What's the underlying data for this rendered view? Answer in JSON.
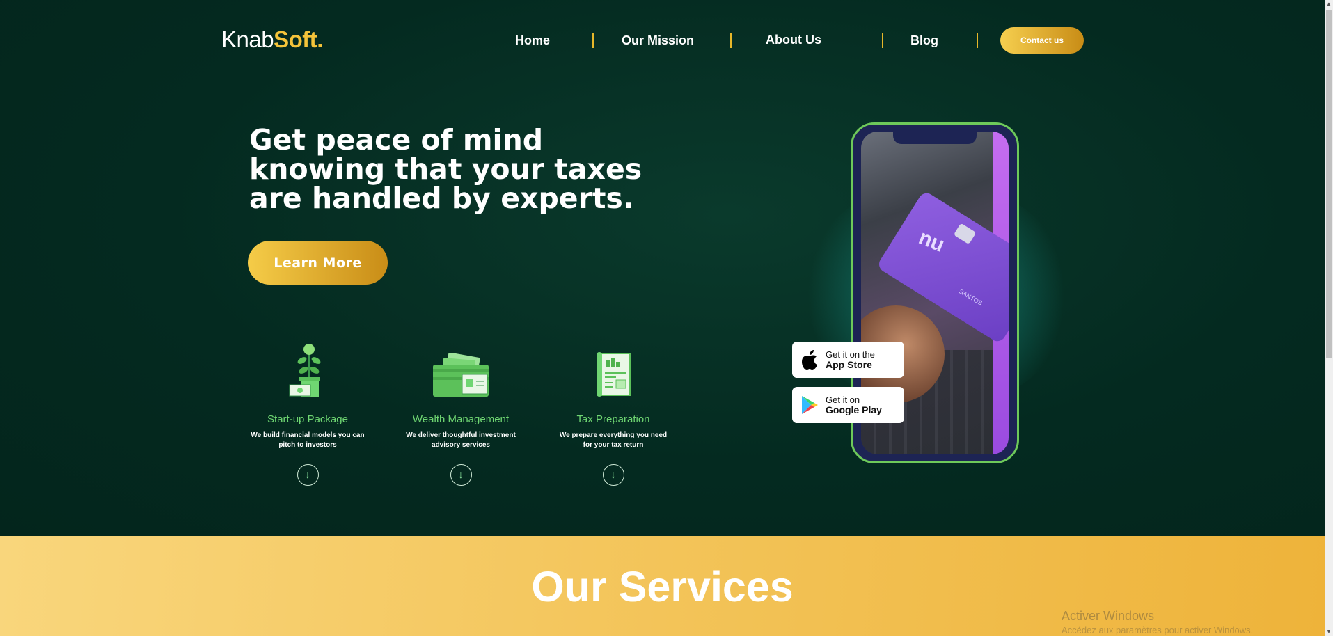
{
  "nav": {
    "logo_part1": "Knab",
    "logo_part2": "Soft.",
    "links": [
      {
        "label": "Home"
      },
      {
        "label": "Our Mission"
      },
      {
        "label": "About Us"
      },
      {
        "label": "Blog"
      }
    ],
    "contact_label": "Contact us"
  },
  "hero": {
    "headline": "Get peace of mind knowing that your taxes are handled by experts.",
    "cta_label": "Learn More"
  },
  "features": [
    {
      "icon": "plant-money-icon",
      "title": "Start-up Package",
      "desc": "We build financial models you can pitch to investors"
    },
    {
      "icon": "wallet-cash-icon",
      "title": "Wealth Management",
      "desc": "We deliver thoughtful investment advisory services"
    },
    {
      "icon": "tax-document-icon",
      "title": "Tax Preparation",
      "desc": "We prepare everything you need for your tax return"
    }
  ],
  "stores": {
    "apple_small": "Get it on the",
    "apple_big": "App Store",
    "google_small": "Get it on",
    "google_big": "Google Play"
  },
  "phone": {
    "card_brand": "nu",
    "card_name": "SANTOS"
  },
  "services": {
    "title": "Our Services"
  },
  "watermark": {
    "title": "Activer Windows",
    "subtitle": "Accédez aux paramètres pour activer Windows."
  },
  "colors": {
    "background": "#042a20",
    "accent": "#f4c33a",
    "feature_title": "#6fd672",
    "services_bg": "#f3c459"
  }
}
